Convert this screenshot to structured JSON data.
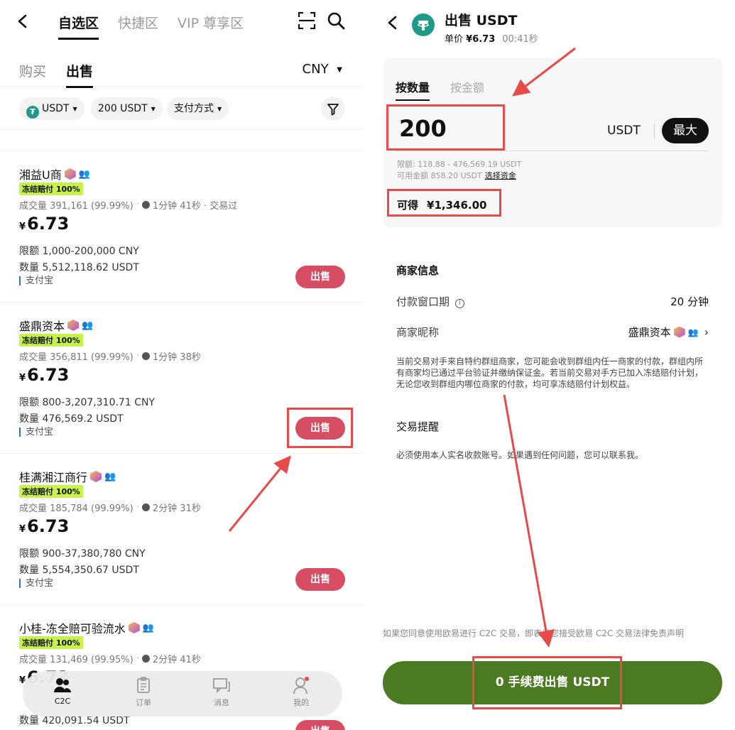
{
  "left": {
    "nav_tabs": [
      "自选区",
      "快捷区",
      "VIP 尊享区"
    ],
    "sub_tabs": [
      "购买",
      "出售"
    ],
    "currency": "CNY",
    "filters": [
      "USDT",
      "200 USDT",
      "支付方式"
    ],
    "merchants": [
      {
        "name": "湘益U商",
        "badge": "冻结赔付 100%",
        "stats_volume": "成交量 391,161 (99.99%)",
        "stats_time": "1分钟 41秒",
        "stats_extra": "· 交易过",
        "price": "6.73",
        "limit": "限额 1,000-200,000 CNY",
        "qty": "数量 5,512,118.62 USDT",
        "pay": "支付宝",
        "action": "出售"
      },
      {
        "name": "盛鼎资本",
        "badge": "冻结赔付 100%",
        "stats_volume": "成交量 356,811 (99.99%)",
        "stats_time": "1分钟 38秒",
        "stats_extra": "",
        "price": "6.73",
        "limit": "限额 800-3,207,310.71 CNY",
        "qty": "数量 476,569.2 USDT",
        "pay": "支付宝",
        "action": "出售"
      },
      {
        "name": "桂满湘江商行",
        "badge": "冻结赔付 100%",
        "stats_volume": "成交量 185,784 (99.99%)",
        "stats_time": "2分钟 31秒",
        "stats_extra": "",
        "price": "6.73",
        "limit": "限额 900-37,380,780 CNY",
        "qty": "数量 5,554,350.67 USDT",
        "pay": "支付宝",
        "action": "出售"
      },
      {
        "name": "小桂-冻全赔可验流水",
        "badge": "冻结赔付 100%",
        "stats_volume": "成交量 131,469 (99.95%)",
        "stats_time": "2分钟 41秒",
        "stats_extra": "",
        "price": "6.73",
        "limit": "",
        "qty": "数量 420,091.54 USDT",
        "pay": "",
        "action": "出售"
      }
    ],
    "bottom_nav": [
      "C2C",
      "订单",
      "消息",
      "我的"
    ]
  },
  "right": {
    "title": "出售 USDT",
    "unit_price_label": "单价",
    "unit_price": "¥6.73",
    "countdown": "00:41秒",
    "mode_tabs": [
      "按数量",
      "按金额"
    ],
    "amount": "200",
    "amount_unit": "USDT",
    "max_label": "最大",
    "limit_text": "限额: 118.88 - 476,569.19 USDT",
    "available_text": "可用金额 858.20 USDT",
    "select_funds": "选择资金",
    "receive_label": "可得",
    "receive_amount": "¥1,346.00",
    "merchant_info_title": "商家信息",
    "payment_window_label": "付款窗口期",
    "payment_window_value": "20 分钟",
    "merchant_nick_label": "商家昵称",
    "merchant_nick_value": "盛鼎资本",
    "group_note": "当前交易对手来自特约群组商家，您可能会收到群组内任一商家的付款，群组内所有商家均已通过平台验证并缴纳保证金。若当前交易对手方已加入冻结赔付计划，无论您收到群组内哪位商家的付款，均可享冻结赔付计划权益。",
    "trade_tip_title": "交易提醒",
    "trade_tip": "必须使用本人实名收款账号。如果遇到任何问题，您可以联系我。",
    "legal": "如果您同意使用欧易进行 C2C 交易，即表示您接受欧易 C2C 交易法律免责声明",
    "cta": "0 手续费出售 USDT"
  },
  "colors": {
    "sell": "#d74d63",
    "cta": "#4b7a23",
    "badge": "#c6f24a",
    "highlight": "#e84a4a"
  }
}
